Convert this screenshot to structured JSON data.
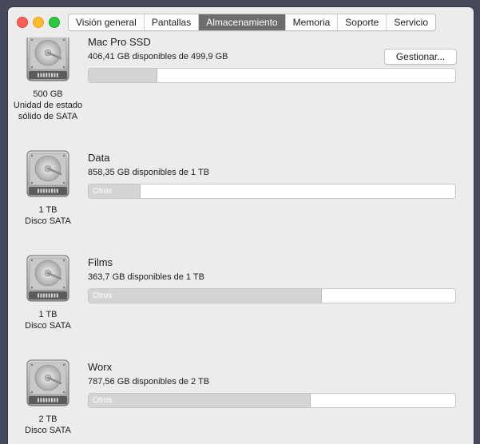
{
  "window": {
    "tabs": [
      {
        "label": "Visión general",
        "active": false
      },
      {
        "label": "Pantallas",
        "active": false
      },
      {
        "label": "Almacenamiento",
        "active": true
      },
      {
        "label": "Memoria",
        "active": false
      },
      {
        "label": "Soporte",
        "active": false
      },
      {
        "label": "Servicio",
        "active": false
      }
    ]
  },
  "manage_button": "Gestionar...",
  "disks": [
    {
      "icon": "hard-drive-icon",
      "name": "Mac Pro SSD",
      "available": "406,41 GB disponibles de 499,9 GB",
      "capacity": "500 GB",
      "type_line1": "Unidad de estado",
      "type_line2": "sólido de SATA",
      "used_fraction": 0.187,
      "bar_label": ""
    },
    {
      "icon": "hard-drive-icon",
      "name": "Data",
      "available": "858,35 GB disponibles de 1 TB",
      "capacity": "1 TB",
      "type_line1": "Disco SATA",
      "type_line2": "",
      "used_fraction": 0.142,
      "bar_label": "Otros"
    },
    {
      "icon": "hard-drive-icon",
      "name": "Films",
      "available": "363,7 GB disponibles de 1 TB",
      "capacity": "1 TB",
      "type_line1": "Disco SATA",
      "type_line2": "",
      "used_fraction": 0.636,
      "bar_label": "Otros"
    },
    {
      "icon": "hard-drive-icon",
      "name": "Worx",
      "available": "787,56 GB disponibles de 2 TB",
      "capacity": "2 TB",
      "type_line1": "Disco SATA",
      "type_line2": "",
      "used_fraction": 0.606,
      "bar_label": "Otros"
    }
  ],
  "colors": {
    "tab_active_bg": "#6d6d6d",
    "bar_used": "#d4d4d4",
    "bar_free": "#ffffff"
  }
}
